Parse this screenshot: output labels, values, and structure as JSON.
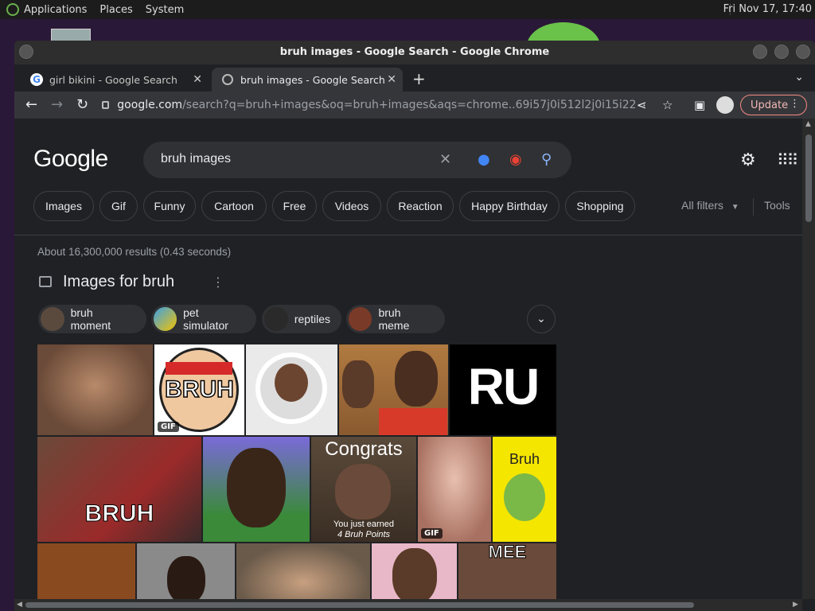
{
  "panel": {
    "menus": [
      "Applications",
      "Places",
      "System"
    ],
    "clock": "Fri Nov 17, 17:40"
  },
  "window": {
    "title": "bruh images - Google Search - Google Chrome"
  },
  "tabs": [
    {
      "label": "girl bikini - Google Search",
      "active": false
    },
    {
      "label": "bruh images - Google Search",
      "active": true
    }
  ],
  "toolbar": {
    "url_host": "google.com",
    "url_path": "/search?q=bruh+images&oq=bruh+images&aqs=chrome..69i57j0i512l2j0i15i22i30j0i22i...",
    "update_label": "Update"
  },
  "google": {
    "logo": "Google",
    "query": "bruh images",
    "chips": [
      "Images",
      "Gif",
      "Funny",
      "Cartoon",
      "Free",
      "Videos",
      "Reaction",
      "Happy Birthday",
      "Shopping"
    ],
    "all_filters": "All filters",
    "tools": "Tools",
    "result_stats": "About 16,300,000 results (0.43 seconds)",
    "images_section_title": "Images for bruh",
    "refinements": [
      "bruh moment",
      "pet simulator",
      "reptiles",
      "bruh meme"
    ],
    "image_texts": {
      "bruh_logo": "BRUH",
      "ru": "RU",
      "bruh_caption": "BRUH",
      "congrats": "Congrats",
      "congrats_sub1": "You just earned",
      "congrats_sub2": "4 Bruh Points",
      "bruh_yellow": "Bruh",
      "mee": "MEE",
      "gif_badge": "GIF"
    }
  },
  "colors": {
    "page_bg": "#202124",
    "toolbar_bg": "#35363a",
    "update_border": "#f28b82",
    "mic_blue": "#4285f4",
    "search_blue": "#8ab4f8"
  }
}
